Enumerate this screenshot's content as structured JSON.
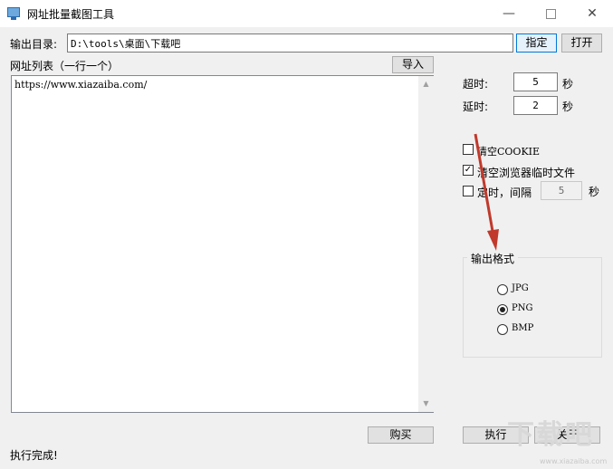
{
  "window": {
    "title": "网址批量截图工具",
    "minimize_glyph": "—",
    "close_glyph": "✕"
  },
  "output": {
    "label": "输出目录:",
    "path": "D:\\tools\\桌面\\下载吧",
    "specify_button": "指定",
    "open_button": "打开"
  },
  "url_list": {
    "label": "网址列表（一行一个）",
    "import_button": "导入",
    "content": "https://www.xiazaiba.com/"
  },
  "timeout": {
    "label": "超时:",
    "value": "5",
    "unit": "秒"
  },
  "delay": {
    "label": "延时:",
    "value": "2",
    "unit": "秒"
  },
  "options": {
    "clear_cookie": {
      "label": "清空COOKIE",
      "checked": false
    },
    "clear_temp": {
      "label": "清空浏览器临时文件",
      "checked": true
    },
    "timer": {
      "label": "定时，间隔",
      "checked": false,
      "value": "5",
      "unit": "秒"
    }
  },
  "format": {
    "title": "输出格式",
    "options": [
      {
        "label": "JPG",
        "selected": false
      },
      {
        "label": "PNG",
        "selected": true
      },
      {
        "label": "BMP",
        "selected": false
      }
    ]
  },
  "buttons": {
    "buy": "购买",
    "execute": "执行",
    "about": "关于"
  },
  "status": "执行完成!",
  "watermark": {
    "text": "下载吧",
    "url": "www.xiazaiba.com"
  },
  "colors": {
    "arrow": "#c0392b",
    "focus_border": "#0078d7"
  }
}
